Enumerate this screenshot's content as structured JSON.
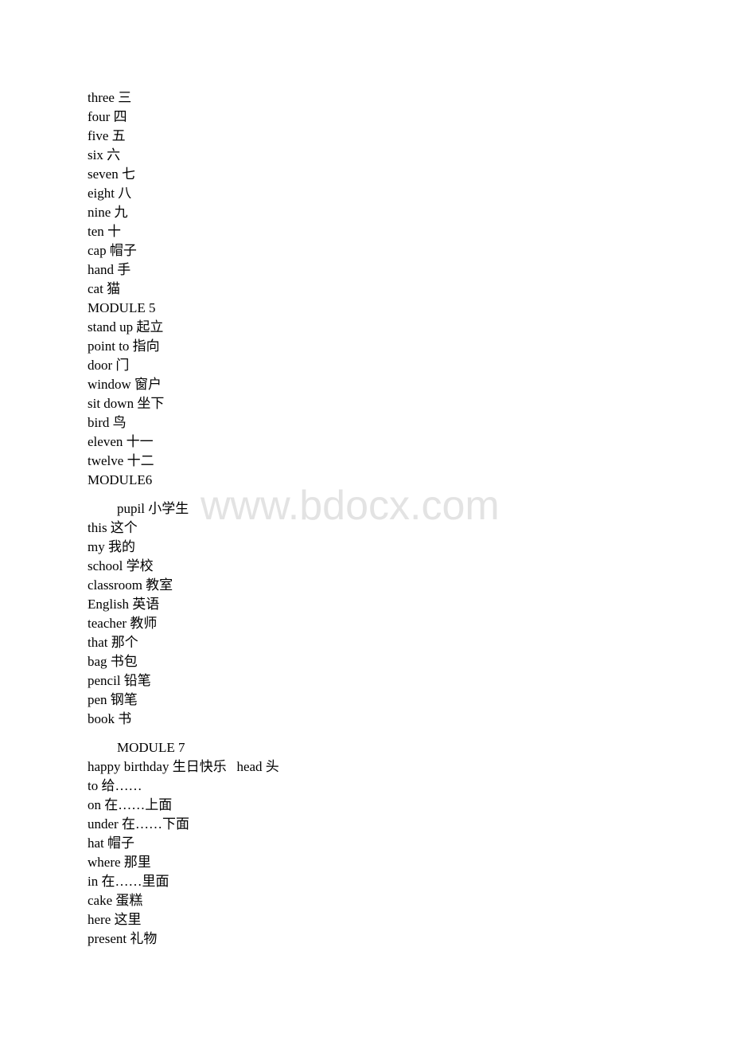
{
  "watermark": "www.bdocx.com",
  "lines_a": [
    "three 三",
    "four 四",
    "five 五",
    "six 六",
    "seven 七",
    "eight 八",
    "nine 九",
    "ten 十",
    "cap 帽子",
    "hand 手",
    "cat 猫",
    "MODULE 5",
    "stand up 起立",
    "point to 指向",
    "door 门",
    "window 窗户",
    "sit down 坐下",
    "bird 鸟",
    "eleven 十一",
    "twelve 十二",
    "MODULE6"
  ],
  "pupil_line": "pupil 小学生",
  "lines_b": [
    "this 这个",
    "my 我的",
    "school 学校",
    "classroom 教室",
    "English 英语",
    "teacher 教师",
    "that 那个",
    "bag 书包",
    "pencil 铅笔",
    "pen 钢笔",
    "book 书"
  ],
  "module7_heading": "MODULE 7",
  "lines_c": [
    "happy birthday 生日快乐   head 头",
    "to 给……",
    "on 在……上面",
    "under 在……下面",
    "hat 帽子",
    "where 那里",
    "in 在……里面",
    "cake 蛋糕",
    "here 这里",
    "present 礼物"
  ]
}
